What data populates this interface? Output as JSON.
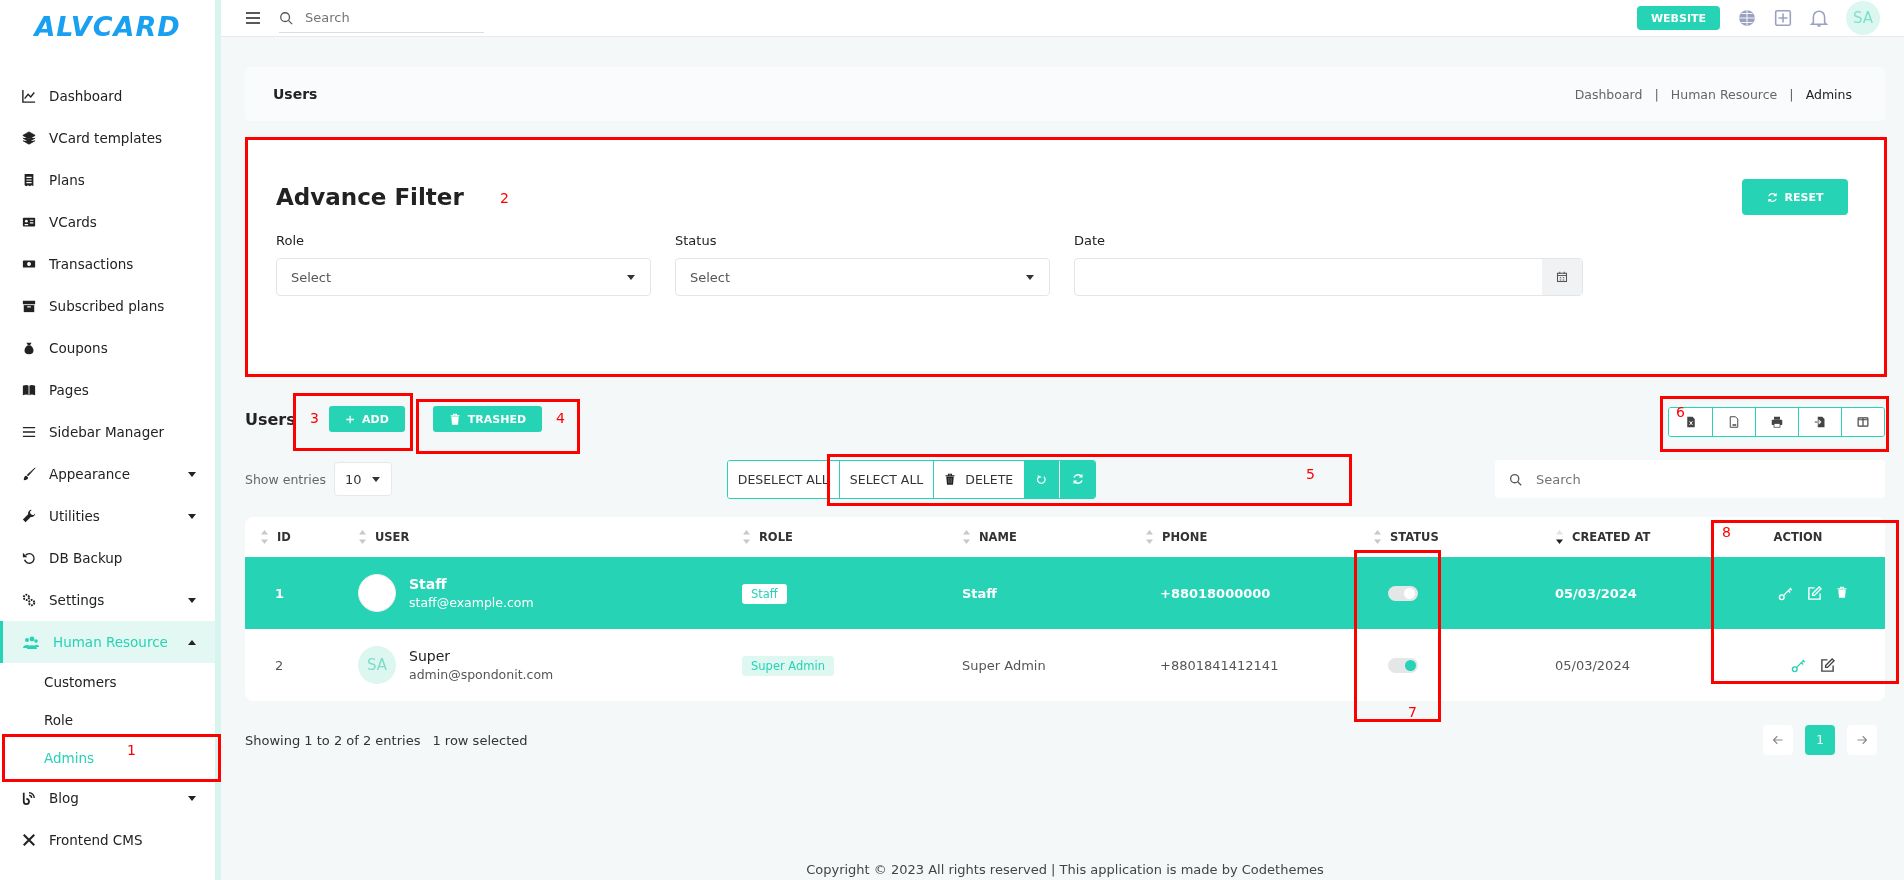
{
  "sidebar": {
    "logo": "ALVCARD",
    "items": [
      {
        "label": "Dashboard",
        "kind": "link",
        "selected": false
      },
      {
        "label": "VCard templates",
        "kind": "link",
        "selected": false
      },
      {
        "label": "Plans",
        "kind": "link",
        "selected": false
      },
      {
        "label": "VCards",
        "kind": "link",
        "selected": false
      },
      {
        "label": "Transactions",
        "kind": "link",
        "selected": false
      },
      {
        "label": "Subscribed plans",
        "kind": "link",
        "selected": false
      },
      {
        "label": "Coupons",
        "kind": "link",
        "selected": false
      },
      {
        "label": "Pages",
        "kind": "link",
        "selected": false
      },
      {
        "label": "Sidebar Manager",
        "kind": "link",
        "selected": false
      },
      {
        "label": "Appearance",
        "kind": "group",
        "selected": false,
        "expanded": false
      },
      {
        "label": "Utilities",
        "kind": "group",
        "selected": false,
        "expanded": false
      },
      {
        "label": "DB Backup",
        "kind": "link",
        "selected": false
      },
      {
        "label": "Settings",
        "kind": "group",
        "selected": false,
        "expanded": false
      },
      {
        "label": "Human Resource",
        "kind": "group",
        "selected": true,
        "expanded": true,
        "children": [
          {
            "label": "Customers",
            "selected": false
          },
          {
            "label": "Role",
            "selected": false
          },
          {
            "label": "Admins",
            "selected": true
          }
        ]
      },
      {
        "label": "Blog",
        "kind": "group",
        "selected": false,
        "expanded": false
      },
      {
        "label": "Frontend CMS",
        "kind": "link",
        "selected": false
      }
    ]
  },
  "top_bar": {
    "search": {
      "placeholder": "Search"
    },
    "website_button": "WEBSITE",
    "avatar": "SA"
  },
  "breadcrumb": {
    "title": "Users",
    "separator": "|",
    "crumbs": [
      {
        "label": "Dashboard",
        "current": false
      },
      {
        "label": "Human Resource",
        "current": false
      },
      {
        "label": "Admins",
        "current": true
      }
    ]
  },
  "filter": {
    "title": "Advance Filter",
    "reset_button": "RESET",
    "fields": [
      {
        "label": "Role",
        "kind": "select",
        "placeholder": "Select"
      },
      {
        "label": "Status",
        "kind": "select",
        "placeholder": "Select"
      },
      {
        "label": "Date",
        "kind": "date"
      }
    ]
  },
  "users": {
    "heading": "Users",
    "add_button": "ADD",
    "trashed_button": "TRASHED",
    "show_entries_label": "Show entries",
    "page_size": "10",
    "bulk_actions": [
      {
        "label": "DESELECT ALL",
        "kind": "text"
      },
      {
        "label": "SELECT ALL",
        "kind": "text"
      },
      {
        "label": "DELETE",
        "kind": "delete"
      }
    ],
    "search": {
      "placeholder": "Search"
    }
  },
  "table": {
    "columns": [
      {
        "label": "ID",
        "sortable": true,
        "sorted_descending": false
      },
      {
        "label": "USER",
        "sortable": true,
        "sorted_descending": false
      },
      {
        "label": "ROLE",
        "sortable": true,
        "sorted_descending": false
      },
      {
        "label": "NAME",
        "sortable": true,
        "sorted_descending": false
      },
      {
        "label": "PHONE",
        "sortable": true,
        "sorted_descending": false
      },
      {
        "label": "STATUS",
        "sortable": true,
        "sorted_descending": false
      },
      {
        "label": "CREATED AT",
        "sortable": true,
        "sorted_descending": true
      },
      {
        "label": "ACTION",
        "sortable": false
      }
    ],
    "rows": [
      {
        "id": "1",
        "avatar": {
          "kind": "image"
        },
        "user": "Staff",
        "email": "staff@example.com",
        "role": "Staff",
        "name": "Staff",
        "phone": "+88018000000",
        "active": true,
        "created_at": "05/03/2024",
        "can_delete": true,
        "selected": true
      },
      {
        "id": "2",
        "avatar": {
          "kind": "initials",
          "text": "SA"
        },
        "user": "Super",
        "email": "admin@spondonit.com",
        "role": "Super Admin",
        "name": "Super Admin",
        "phone": "+8801841412141",
        "active": true,
        "created_at": "05/03/2024",
        "can_delete": false,
        "selected": false
      }
    ]
  },
  "table_info": {
    "showing": "Showing 1 to 2 of 2 entries",
    "selection": "1 row selected"
  },
  "pagination": {
    "pages": [
      {
        "label": "1",
        "selected": true
      }
    ]
  },
  "footer": "Copyright © 2023 All rights reserved | This application is made by Codethemes",
  "annotations": [
    {
      "number": "1"
    },
    {
      "number": "2"
    },
    {
      "number": "3"
    },
    {
      "number": "4"
    },
    {
      "number": "5"
    },
    {
      "number": "6"
    },
    {
      "number": "7"
    },
    {
      "number": "8"
    }
  ]
}
